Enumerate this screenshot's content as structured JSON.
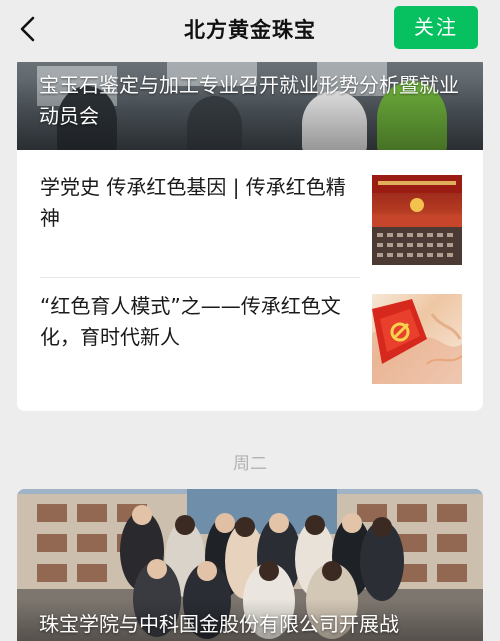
{
  "header": {
    "title": "北方黄金珠宝",
    "follow_label": "关注",
    "back_icon": "chevron-left-icon"
  },
  "card1": {
    "hero_title": "宝玉石鉴定与加工专业召开就业形势分析暨就业动员会",
    "items": [
      {
        "title": "学党史 传承红色基因 | 传承红色精神"
      },
      {
        "title": "“红色育人模式”之——传承红色文化，育时代新人"
      }
    ]
  },
  "day_label": "周二",
  "card2": {
    "hero_title": "珠宝学院与中科国金股份有限公司开展战"
  },
  "colors": {
    "accent": "#07c160",
    "background": "#ededed"
  }
}
